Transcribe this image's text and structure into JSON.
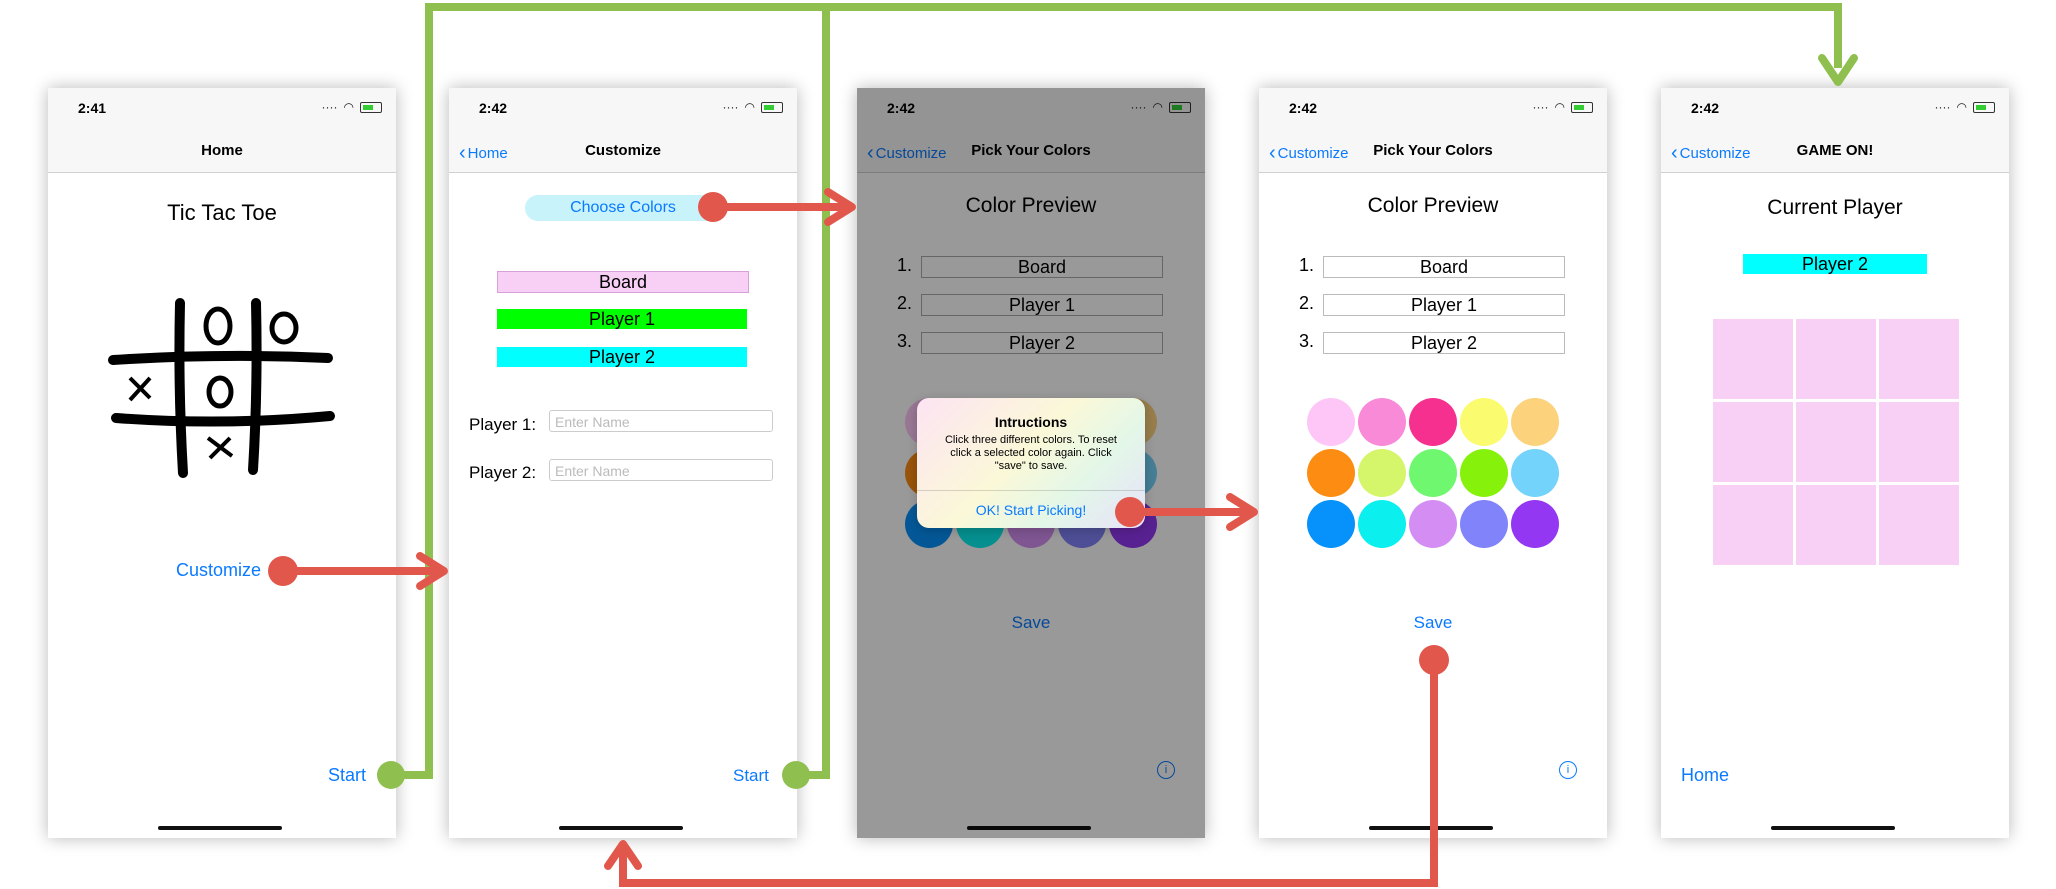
{
  "status": {
    "time1": "2:41",
    "time2": "2:42",
    "time3": "2:42",
    "time4": "2:42",
    "time5": "2:42"
  },
  "screen1": {
    "nav_title": "Home",
    "title": "Tic Tac Toe",
    "customize": "Customize",
    "start": "Start"
  },
  "screen2": {
    "back": "Home",
    "nav_title": "Customize",
    "choose_colors": "Choose Colors",
    "preview": [
      "Board",
      "Player 1",
      "Player 2"
    ],
    "p1_label": "Player 1:",
    "p2_label": "Player 2:",
    "placeholder": "Enter Name",
    "start": "Start"
  },
  "screen3": {
    "back": "Customize",
    "nav_title": "Pick Your Colors",
    "preview_title": "Color Preview",
    "numbers": [
      "1.",
      "2.",
      "3."
    ],
    "fields": [
      "Board",
      "Player 1",
      "Player 2"
    ],
    "alert_title": "Intructions",
    "alert_body": "Click three different colors. To reset click a selected color again. Click \"save\" to save.",
    "alert_button": "OK! Start Picking!",
    "save": "Save",
    "info_icon": "info-icon"
  },
  "screen4": {
    "back": "Customize",
    "nav_title": "Pick Your Colors",
    "preview_title": "Color Preview",
    "numbers": [
      "1.",
      "2.",
      "3."
    ],
    "fields": [
      "Board",
      "Player 1",
      "Player 2"
    ],
    "save": "Save",
    "palette": [
      "#fdc6f7",
      "#f98ad8",
      "#f6308f",
      "#fbfb6f",
      "#fcd27d",
      "#fd8c12",
      "#d5f56b",
      "#6ff770",
      "#86f20b",
      "#73d3fa",
      "#0791fb",
      "#0befef",
      "#d48ef3",
      "#8083f9",
      "#9337f2"
    ]
  },
  "screen5": {
    "back": "Customize",
    "nav_title": "GAME ON!",
    "title": "Current Player",
    "player": "Player 2",
    "home": "Home"
  },
  "colors": {
    "board": "#f8d0f6",
    "player1": "#00ff00",
    "player2": "#00ffff",
    "ios_blue": "#0a7aff",
    "arrow_red": "#e2574c",
    "arrow_green": "#8fbf4f"
  }
}
